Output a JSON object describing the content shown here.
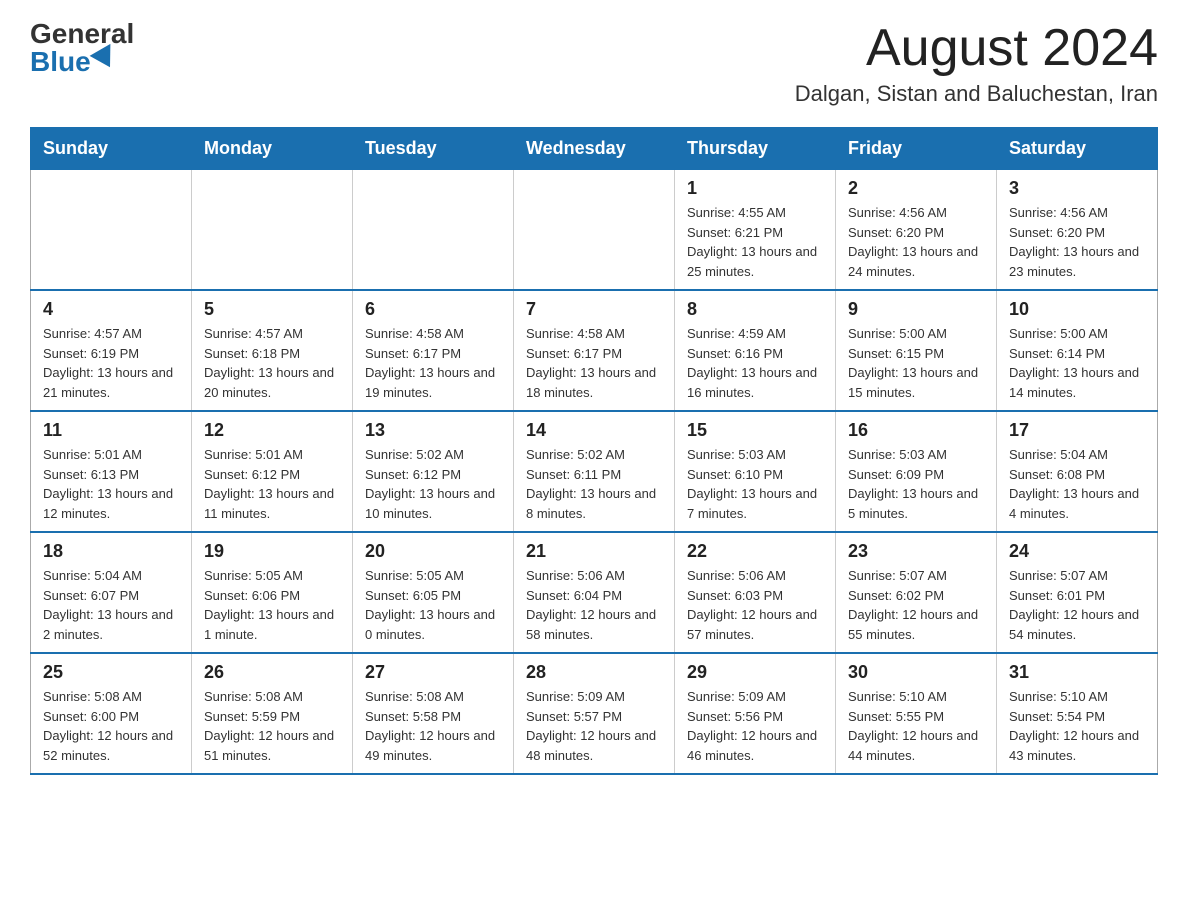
{
  "logo": {
    "general": "General",
    "blue": "Blue"
  },
  "header": {
    "month": "August 2024",
    "location": "Dalgan, Sistan and Baluchestan, Iran"
  },
  "weekdays": [
    "Sunday",
    "Monday",
    "Tuesday",
    "Wednesday",
    "Thursday",
    "Friday",
    "Saturday"
  ],
  "weeks": [
    [
      {
        "day": "",
        "info": ""
      },
      {
        "day": "",
        "info": ""
      },
      {
        "day": "",
        "info": ""
      },
      {
        "day": "",
        "info": ""
      },
      {
        "day": "1",
        "info": "Sunrise: 4:55 AM\nSunset: 6:21 PM\nDaylight: 13 hours and 25 minutes."
      },
      {
        "day": "2",
        "info": "Sunrise: 4:56 AM\nSunset: 6:20 PM\nDaylight: 13 hours and 24 minutes."
      },
      {
        "day": "3",
        "info": "Sunrise: 4:56 AM\nSunset: 6:20 PM\nDaylight: 13 hours and 23 minutes."
      }
    ],
    [
      {
        "day": "4",
        "info": "Sunrise: 4:57 AM\nSunset: 6:19 PM\nDaylight: 13 hours and 21 minutes."
      },
      {
        "day": "5",
        "info": "Sunrise: 4:57 AM\nSunset: 6:18 PM\nDaylight: 13 hours and 20 minutes."
      },
      {
        "day": "6",
        "info": "Sunrise: 4:58 AM\nSunset: 6:17 PM\nDaylight: 13 hours and 19 minutes."
      },
      {
        "day": "7",
        "info": "Sunrise: 4:58 AM\nSunset: 6:17 PM\nDaylight: 13 hours and 18 minutes."
      },
      {
        "day": "8",
        "info": "Sunrise: 4:59 AM\nSunset: 6:16 PM\nDaylight: 13 hours and 16 minutes."
      },
      {
        "day": "9",
        "info": "Sunrise: 5:00 AM\nSunset: 6:15 PM\nDaylight: 13 hours and 15 minutes."
      },
      {
        "day": "10",
        "info": "Sunrise: 5:00 AM\nSunset: 6:14 PM\nDaylight: 13 hours and 14 minutes."
      }
    ],
    [
      {
        "day": "11",
        "info": "Sunrise: 5:01 AM\nSunset: 6:13 PM\nDaylight: 13 hours and 12 minutes."
      },
      {
        "day": "12",
        "info": "Sunrise: 5:01 AM\nSunset: 6:12 PM\nDaylight: 13 hours and 11 minutes."
      },
      {
        "day": "13",
        "info": "Sunrise: 5:02 AM\nSunset: 6:12 PM\nDaylight: 13 hours and 10 minutes."
      },
      {
        "day": "14",
        "info": "Sunrise: 5:02 AM\nSunset: 6:11 PM\nDaylight: 13 hours and 8 minutes."
      },
      {
        "day": "15",
        "info": "Sunrise: 5:03 AM\nSunset: 6:10 PM\nDaylight: 13 hours and 7 minutes."
      },
      {
        "day": "16",
        "info": "Sunrise: 5:03 AM\nSunset: 6:09 PM\nDaylight: 13 hours and 5 minutes."
      },
      {
        "day": "17",
        "info": "Sunrise: 5:04 AM\nSunset: 6:08 PM\nDaylight: 13 hours and 4 minutes."
      }
    ],
    [
      {
        "day": "18",
        "info": "Sunrise: 5:04 AM\nSunset: 6:07 PM\nDaylight: 13 hours and 2 minutes."
      },
      {
        "day": "19",
        "info": "Sunrise: 5:05 AM\nSunset: 6:06 PM\nDaylight: 13 hours and 1 minute."
      },
      {
        "day": "20",
        "info": "Sunrise: 5:05 AM\nSunset: 6:05 PM\nDaylight: 13 hours and 0 minutes."
      },
      {
        "day": "21",
        "info": "Sunrise: 5:06 AM\nSunset: 6:04 PM\nDaylight: 12 hours and 58 minutes."
      },
      {
        "day": "22",
        "info": "Sunrise: 5:06 AM\nSunset: 6:03 PM\nDaylight: 12 hours and 57 minutes."
      },
      {
        "day": "23",
        "info": "Sunrise: 5:07 AM\nSunset: 6:02 PM\nDaylight: 12 hours and 55 minutes."
      },
      {
        "day": "24",
        "info": "Sunrise: 5:07 AM\nSunset: 6:01 PM\nDaylight: 12 hours and 54 minutes."
      }
    ],
    [
      {
        "day": "25",
        "info": "Sunrise: 5:08 AM\nSunset: 6:00 PM\nDaylight: 12 hours and 52 minutes."
      },
      {
        "day": "26",
        "info": "Sunrise: 5:08 AM\nSunset: 5:59 PM\nDaylight: 12 hours and 51 minutes."
      },
      {
        "day": "27",
        "info": "Sunrise: 5:08 AM\nSunset: 5:58 PM\nDaylight: 12 hours and 49 minutes."
      },
      {
        "day": "28",
        "info": "Sunrise: 5:09 AM\nSunset: 5:57 PM\nDaylight: 12 hours and 48 minutes."
      },
      {
        "day": "29",
        "info": "Sunrise: 5:09 AM\nSunset: 5:56 PM\nDaylight: 12 hours and 46 minutes."
      },
      {
        "day": "30",
        "info": "Sunrise: 5:10 AM\nSunset: 5:55 PM\nDaylight: 12 hours and 44 minutes."
      },
      {
        "day": "31",
        "info": "Sunrise: 5:10 AM\nSunset: 5:54 PM\nDaylight: 12 hours and 43 minutes."
      }
    ]
  ]
}
